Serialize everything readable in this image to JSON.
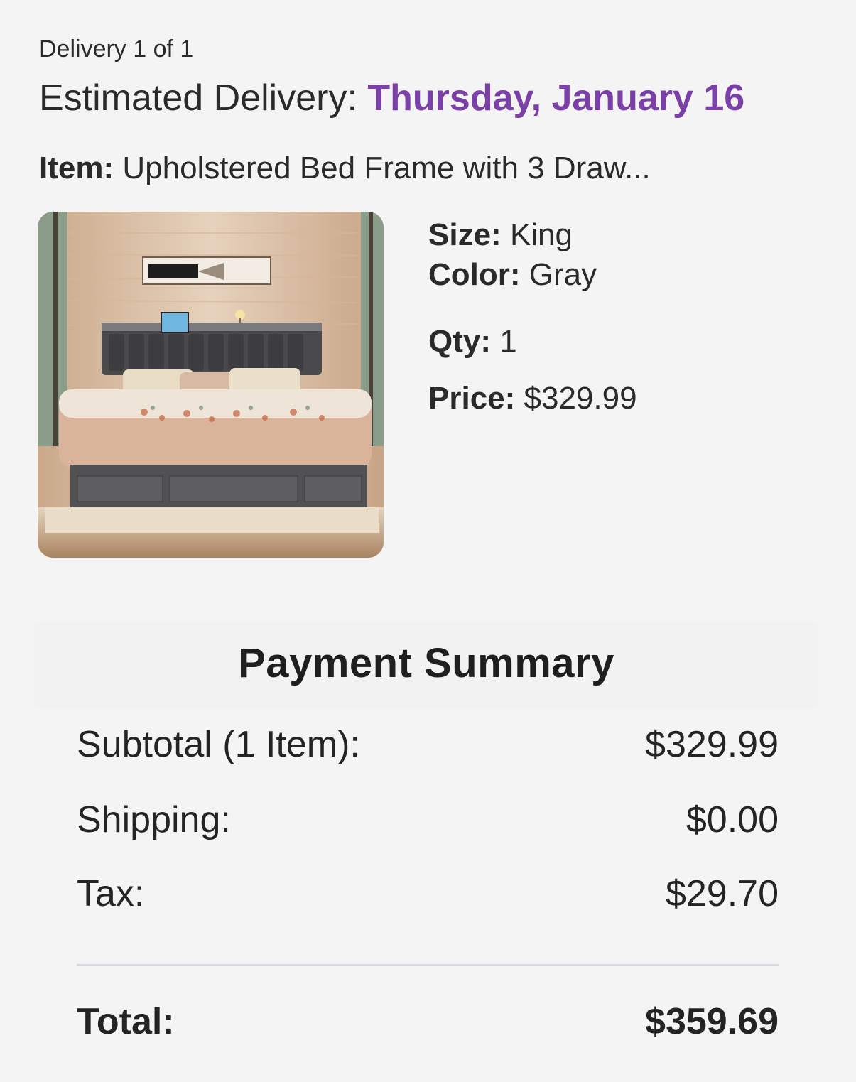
{
  "delivery": {
    "count_label": "Delivery 1 of 1",
    "estimated_label": "Estimated Delivery:",
    "estimated_date": "Thursday, January 16",
    "accent_color": "#7b3fa8"
  },
  "item": {
    "label": "Item:",
    "name": "Upholstered Bed Frame with 3 Draw...",
    "image_alt": "Gray upholstered bed frame in bedroom",
    "size_label": "Size:",
    "size_value": "King",
    "color_label": "Color:",
    "color_value": "Gray",
    "qty_label": "Qty:",
    "qty_value": "1",
    "price_label": "Price:",
    "price_value": "$329.99"
  },
  "summary": {
    "title": "Payment Summary",
    "subtotal_label": "Subtotal (1 Item):",
    "subtotal_value": "$329.99",
    "shipping_label": "Shipping:",
    "shipping_value": "$0.00",
    "tax_label": "Tax:",
    "tax_value": "$29.70",
    "total_label": "Total:",
    "total_value": "$359.69"
  }
}
